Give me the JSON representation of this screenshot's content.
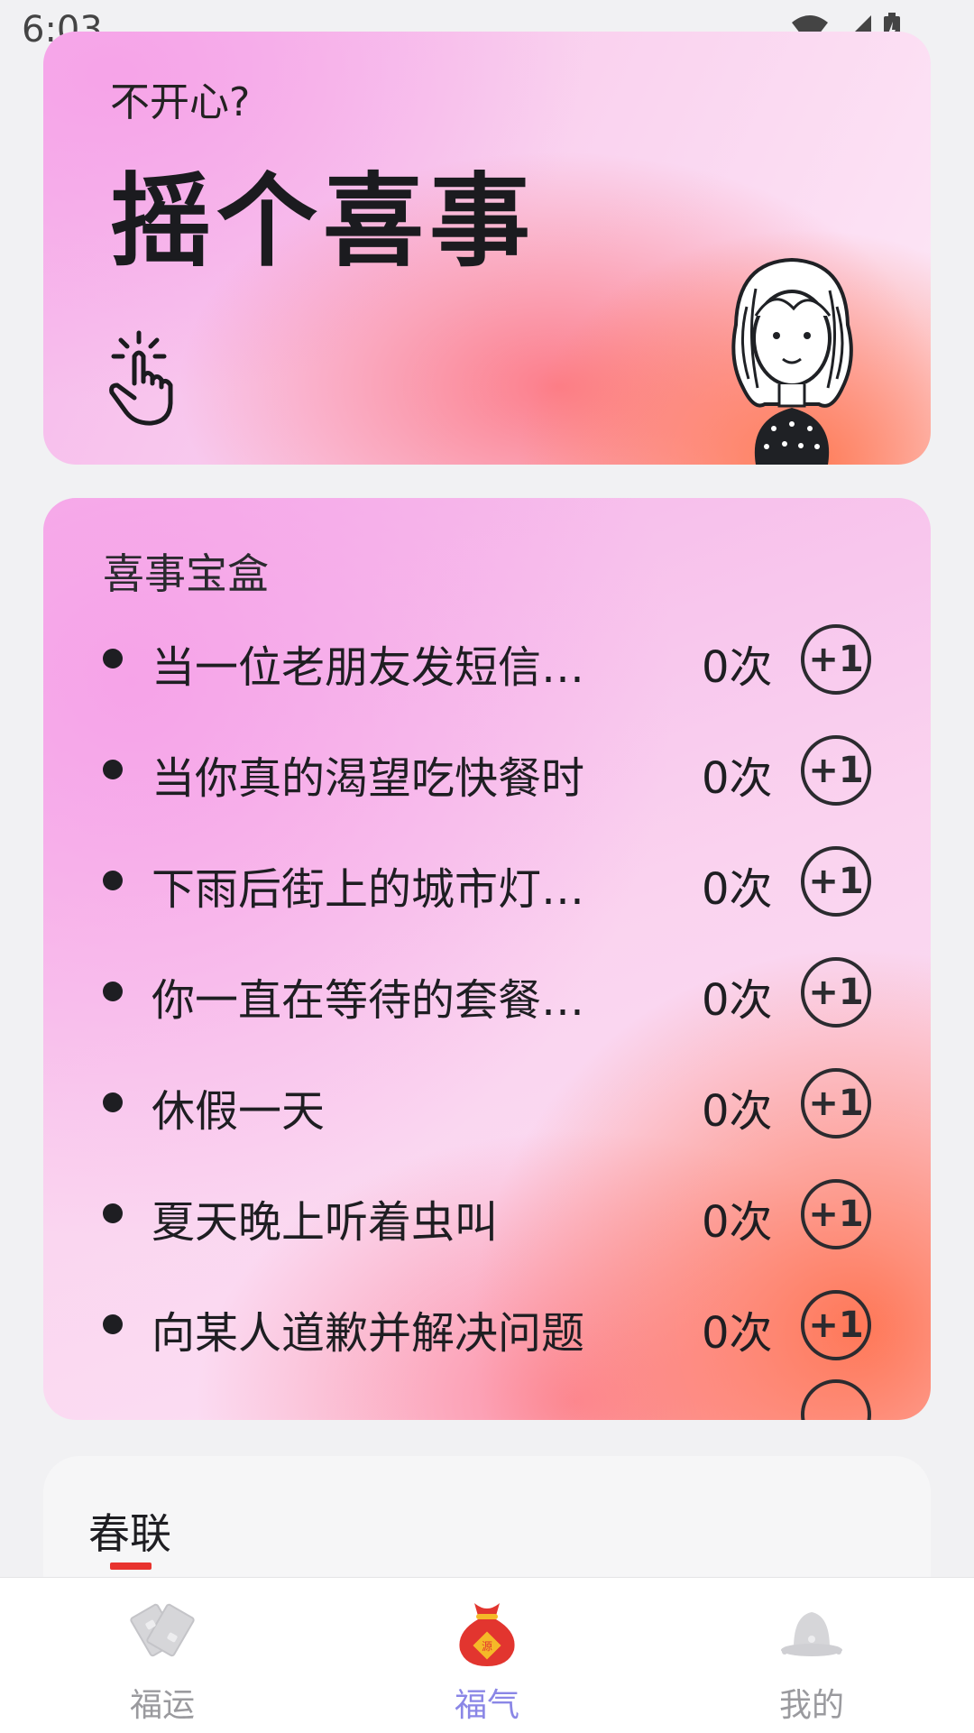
{
  "status_bar": {
    "time": "6:03"
  },
  "hero": {
    "subtitle": "不开心?",
    "title": "摇个喜事"
  },
  "joy_box": {
    "heading": "喜事宝盒",
    "items": [
      {
        "text": "当一位老朋友发短信…",
        "count": "0次",
        "action": "+1"
      },
      {
        "text": "当你真的渴望吃快餐时",
        "count": "0次",
        "action": "+1"
      },
      {
        "text": "下雨后街上的城市灯…",
        "count": "0次",
        "action": "+1"
      },
      {
        "text": "你一直在等待的套餐…",
        "count": "0次",
        "action": "+1"
      },
      {
        "text": "休假一天",
        "count": "0次",
        "action": "+1"
      },
      {
        "text": "夏天晚上听着虫叫",
        "count": "0次",
        "action": "+1"
      },
      {
        "text": "向某人道歉并解决问题",
        "count": "0次",
        "action": "+1"
      }
    ]
  },
  "couplet": {
    "tab": "春联"
  },
  "bottom_nav": {
    "items": [
      {
        "label": "福运",
        "icon": "fortune-cards-icon"
      },
      {
        "label": "福气",
        "icon": "lucky-bag-icon",
        "active": true
      },
      {
        "label": "我的",
        "icon": "profile-bell-icon"
      }
    ]
  },
  "colors": {
    "accent_underline": "#e8332e",
    "active_nav": "#8a86e6",
    "inactive_nav": "#9a9a9e"
  }
}
